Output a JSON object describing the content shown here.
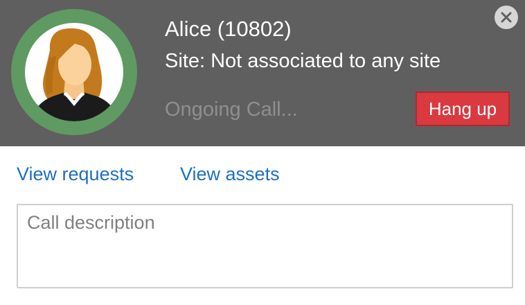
{
  "caller": {
    "name": "Alice (10802)",
    "site": "Site: Not associated to any site",
    "status": "Ongoing Call..."
  },
  "actions": {
    "hangup_label": "Hang up",
    "close_icon": "close-icon"
  },
  "links": {
    "view_requests": "View requests",
    "view_assets": "View assets"
  },
  "description": {
    "value": "",
    "placeholder": "Call description"
  },
  "colors": {
    "header_background": "#5f5f5f",
    "avatar_ring": "#5f9a62",
    "hangup_button": "#d9393f",
    "link": "#1d6fc4",
    "status_text": "#8f8f8f"
  }
}
